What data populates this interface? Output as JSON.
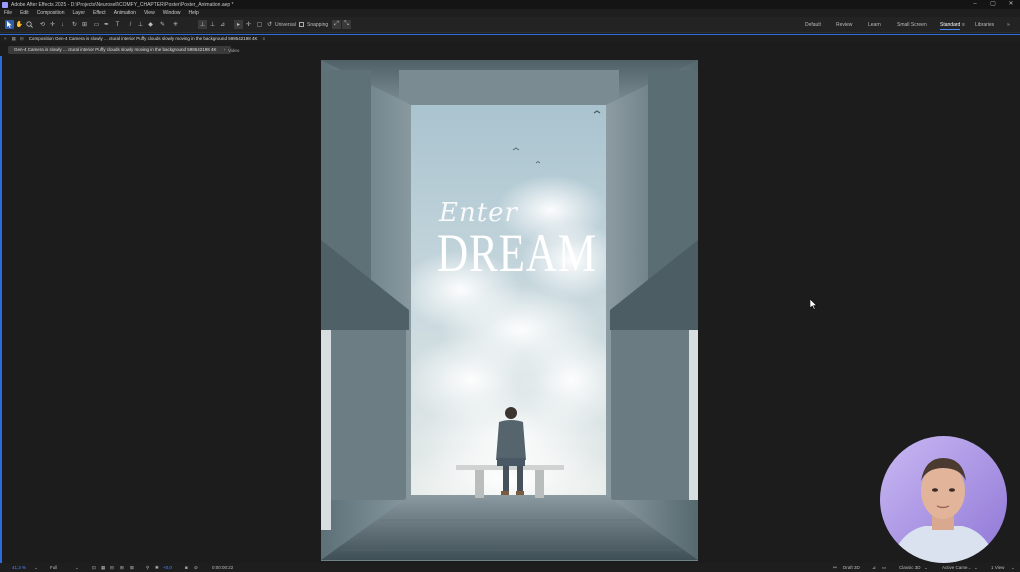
{
  "window": {
    "title": "Adobe After Effects 2025 - D:\\Projects\\Neurosell\\COMFY_CHAPTER\\Poster\\Poster_Animation.aep *",
    "minimize": "–",
    "maximize": "▢",
    "close": "✕"
  },
  "menu": [
    "File",
    "Edit",
    "Composition",
    "Layer",
    "Effect",
    "Animation",
    "View",
    "Window",
    "Help"
  ],
  "toolbar": {
    "universal_label": "Universal",
    "snapping_label": "Snapping"
  },
  "workspaces": [
    "Default",
    "Review",
    "Learn",
    "Small Screen",
    "Standard",
    "Libraries"
  ],
  "workspace_menu_icon": "≡",
  "overflow_icon": "»",
  "composition_panel": {
    "title": "Composition Gen-4 Camera is slowly ... ctural interior Puffy clouds slowly moving in the background 598542198 4K",
    "menu_icon": "≡"
  },
  "viewer_tabs": {
    "active": "Gen-4 Camera is slowly ... ctural interior Puffy clouds slowly moving in the background 598542198 4K",
    "other": "Video"
  },
  "poster": {
    "script_text": "Enter",
    "main_text": "DREAM"
  },
  "status": {
    "zoom": "41,3 %",
    "resolution": "Full",
    "exposure": "+0,0",
    "timecode": "0:00:00:22",
    "renderer_label": "Draft 3D",
    "renderer": "Classic 3D",
    "camera": "Active Came...",
    "views": "1 View"
  },
  "colors": {
    "accent": "#2d6cdf",
    "active_tool": "#2f5fa8",
    "bg": "#1c1c1c"
  }
}
